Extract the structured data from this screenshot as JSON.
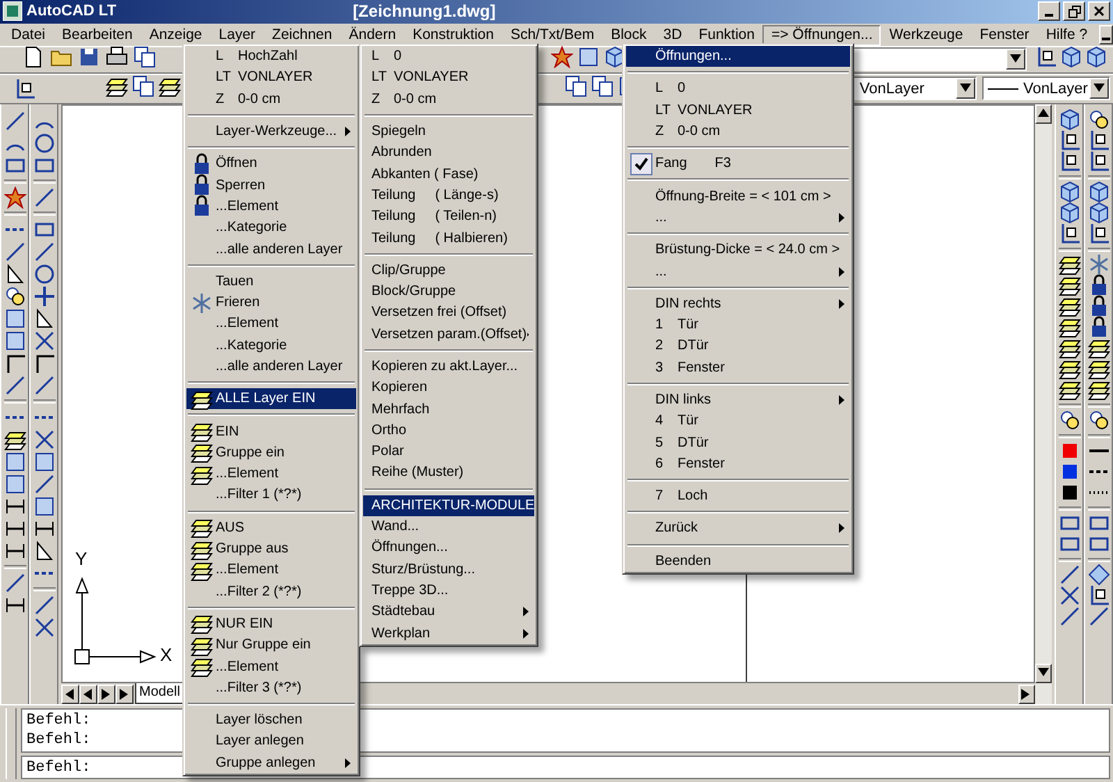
{
  "window": {
    "title": "AutoCAD LT",
    "document": "[Zeichnung1.dwg]"
  },
  "menu_bar": [
    {
      "label": "Datei",
      "selected": false
    },
    {
      "label": "Bearbeiten",
      "selected": false
    },
    {
      "label": "Anzeige",
      "selected": false
    },
    {
      "label": "Layer",
      "selected": false
    },
    {
      "label": "Zeichnen",
      "selected": false
    },
    {
      "label": "Ändern",
      "selected": false
    },
    {
      "label": "Konstruktion",
      "selected": false
    },
    {
      "label": "Sch/Txt/Bem",
      "selected": false
    },
    {
      "label": "Block",
      "selected": false
    },
    {
      "label": "3D",
      "selected": false
    },
    {
      "label": "Funktion",
      "selected": false
    },
    {
      "label": "=> Öffnungen...",
      "selected": true
    },
    {
      "label": "Werkzeuge",
      "selected": false
    },
    {
      "label": "Fenster",
      "selected": false
    },
    {
      "label": "Hilfe ?",
      "selected": false
    }
  ],
  "toolbar": {
    "color_control": "VonLayer",
    "linetype": "VonLayer"
  },
  "canvas": {
    "axis_y": "Y",
    "axis_x": "X"
  },
  "layout_tabs": [
    {
      "label": "Modell",
      "selected": true
    }
  ],
  "command_lines": [
    "Befehl:",
    "Befehl:"
  ],
  "command_prompt": "Befehl:",
  "menus": [
    {
      "items": [
        {
          "kind": "info",
          "key": "L",
          "label": "HochZahl"
        },
        {
          "kind": "info",
          "key": "LT",
          "label": "VONLAYER"
        },
        {
          "kind": "info",
          "key": "Z",
          "label": "0-0 cm"
        },
        {
          "kind": "separator"
        },
        {
          "kind": "item",
          "label": "Layer-Werkzeuge...",
          "selected": false,
          "submenu": true
        },
        {
          "kind": "separator"
        },
        {
          "kind": "item",
          "label": "Öffnen",
          "selected": false
        },
        {
          "kind": "item",
          "label": "Sperren",
          "selected": false
        },
        {
          "kind": "item",
          "label": "...Element",
          "selected": false
        },
        {
          "kind": "item",
          "label": "...Kategorie",
          "selected": false
        },
        {
          "kind": "item",
          "label": "...alle anderen Layer",
          "selected": false
        },
        {
          "kind": "separator"
        },
        {
          "kind": "item",
          "label": "Tauen",
          "selected": false
        },
        {
          "kind": "item",
          "label": "Frieren",
          "selected": false
        },
        {
          "kind": "item",
          "label": "...Element",
          "selected": false
        },
        {
          "kind": "item",
          "label": "...Kategorie",
          "selected": false
        },
        {
          "kind": "item",
          "label": "...alle anderen Layer",
          "selected": false
        },
        {
          "kind": "separator"
        },
        {
          "kind": "item",
          "label": "ALLE Layer EIN",
          "selected": true
        },
        {
          "kind": "separator"
        },
        {
          "kind": "item",
          "label": "EIN",
          "selected": false
        },
        {
          "kind": "item",
          "label": "Gruppe ein",
          "selected": false
        },
        {
          "kind": "item",
          "label": "...Element",
          "selected": false
        },
        {
          "kind": "item",
          "label": "...Filter 1 (*?*)",
          "selected": false
        },
        {
          "kind": "separator"
        },
        {
          "kind": "item",
          "label": "AUS",
          "selected": false
        },
        {
          "kind": "item",
          "label": "Gruppe aus",
          "selected": false
        },
        {
          "kind": "item",
          "label": "...Element",
          "selected": false
        },
        {
          "kind": "item",
          "label": "...Filter 2 (*?*)",
          "selected": false
        },
        {
          "kind": "separator"
        },
        {
          "kind": "item",
          "label": "NUR EIN",
          "selected": false
        },
        {
          "kind": "item",
          "label": "Nur Gruppe ein",
          "selected": false
        },
        {
          "kind": "item",
          "label": "...Element",
          "selected": false
        },
        {
          "kind": "item",
          "label": "...Filter 3 (*?*)",
          "selected": false
        },
        {
          "kind": "separator"
        },
        {
          "kind": "item",
          "label": "Layer löschen",
          "selected": false
        },
        {
          "kind": "item",
          "label": "Layer anlegen",
          "selected": false
        },
        {
          "kind": "item",
          "label": "Gruppe anlegen",
          "selected": false,
          "submenu": true
        }
      ]
    },
    {
      "items": [
        {
          "kind": "info",
          "key": "L",
          "label": "0"
        },
        {
          "kind": "info",
          "key": "LT",
          "label": "VONLAYER"
        },
        {
          "kind": "info",
          "key": "Z",
          "label": "0-0 cm"
        },
        {
          "kind": "separator"
        },
        {
          "kind": "item",
          "label": "Spiegeln",
          "selected": false
        },
        {
          "kind": "item",
          "label": "Abrunden",
          "selected": false
        },
        {
          "kind": "item",
          "label": "Abkanten ( Fase)",
          "selected": false
        },
        {
          "kind": "item",
          "label": "Teilung",
          "detail": "( Länge-s)",
          "selected": false
        },
        {
          "kind": "item",
          "label": "Teilung",
          "detail": "( Teilen-n)",
          "selected": false
        },
        {
          "kind": "item",
          "label": "Teilung",
          "detail": "( Halbieren)",
          "selected": false
        },
        {
          "kind": "separator"
        },
        {
          "kind": "item",
          "label": "Clip/Gruppe",
          "selected": false
        },
        {
          "kind": "item",
          "label": "Block/Gruppe",
          "selected": false
        },
        {
          "kind": "item",
          "label": "Versetzen frei (Offset)",
          "selected": false
        },
        {
          "kind": "item",
          "label": "Versetzen param.(Offset)",
          "selected": false,
          "submenu": true
        },
        {
          "kind": "separator"
        },
        {
          "kind": "item",
          "label": "Kopieren zu akt.Layer...",
          "selected": false
        },
        {
          "kind": "item",
          "label": "Kopieren",
          "selected": false
        },
        {
          "kind": "item",
          "label": "Mehrfach",
          "selected": false
        },
        {
          "kind": "item",
          "label": "Ortho",
          "selected": false
        },
        {
          "kind": "item",
          "label": "Polar",
          "selected": false
        },
        {
          "kind": "item",
          "label": "Reihe (Muster)",
          "selected": false
        },
        {
          "kind": "separator"
        },
        {
          "kind": "item",
          "label": "ARCHITEKTUR-MODULE",
          "selected": true
        },
        {
          "kind": "item",
          "label": "Wand...",
          "selected": false
        },
        {
          "kind": "item",
          "label": "Öffnungen...",
          "selected": false
        },
        {
          "kind": "item",
          "label": "Sturz/Brüstung...",
          "selected": false
        },
        {
          "kind": "item",
          "label": "Treppe 3D...",
          "selected": false
        },
        {
          "kind": "item",
          "label": "Städtebau",
          "selected": false,
          "submenu": true
        },
        {
          "kind": "item",
          "label": "Werkplan",
          "selected": false,
          "submenu": true
        }
      ]
    },
    {
      "items": [
        {
          "kind": "item",
          "label": "Öffnungen...",
          "selected": true
        },
        {
          "kind": "separator"
        },
        {
          "kind": "info",
          "key": "L",
          "label": "0"
        },
        {
          "kind": "info",
          "key": "LT",
          "label": "VONLAYER"
        },
        {
          "kind": "info",
          "key": "Z",
          "label": "0-0 cm"
        },
        {
          "kind": "separator"
        },
        {
          "kind": "item",
          "label": "Fang",
          "shortcut": "F3",
          "checked": true,
          "selected": false
        },
        {
          "kind": "separator"
        },
        {
          "kind": "item",
          "label": "Öffnung-Breite = < 101 cm >",
          "selected": false
        },
        {
          "kind": "item",
          "label": "...",
          "selected": false,
          "submenu": true
        },
        {
          "kind": "separator"
        },
        {
          "kind": "item",
          "label": "Brüstung-Dicke = < 24.0 cm >",
          "selected": false
        },
        {
          "kind": "item",
          "label": "...",
          "selected": false,
          "submenu": true
        },
        {
          "kind": "separator"
        },
        {
          "kind": "item",
          "label": "DIN rechts",
          "selected": false,
          "submenu": true
        },
        {
          "kind": "item",
          "key": "1",
          "label": "Tür",
          "selected": false
        },
        {
          "kind": "item",
          "key": "2",
          "label": "DTür",
          "selected": false
        },
        {
          "kind": "item",
          "key": "3",
          "label": "Fenster",
          "selected": false
        },
        {
          "kind": "separator"
        },
        {
          "kind": "item",
          "label": "DIN links",
          "selected": false,
          "submenu": true
        },
        {
          "kind": "item",
          "key": "4",
          "label": "Tür",
          "selected": false
        },
        {
          "kind": "item",
          "key": "5",
          "label": "DTür",
          "selected": false
        },
        {
          "kind": "item",
          "key": "6",
          "label": "Fenster",
          "selected": false
        },
        {
          "kind": "separator"
        },
        {
          "kind": "item",
          "key": "7",
          "label": "Loch",
          "selected": false
        },
        {
          "kind": "separator"
        },
        {
          "kind": "item",
          "label": "Zurück",
          "selected": false,
          "submenu": true
        },
        {
          "kind": "separator"
        },
        {
          "kind": "item",
          "label": "Beenden",
          "selected": false
        }
      ]
    }
  ]
}
